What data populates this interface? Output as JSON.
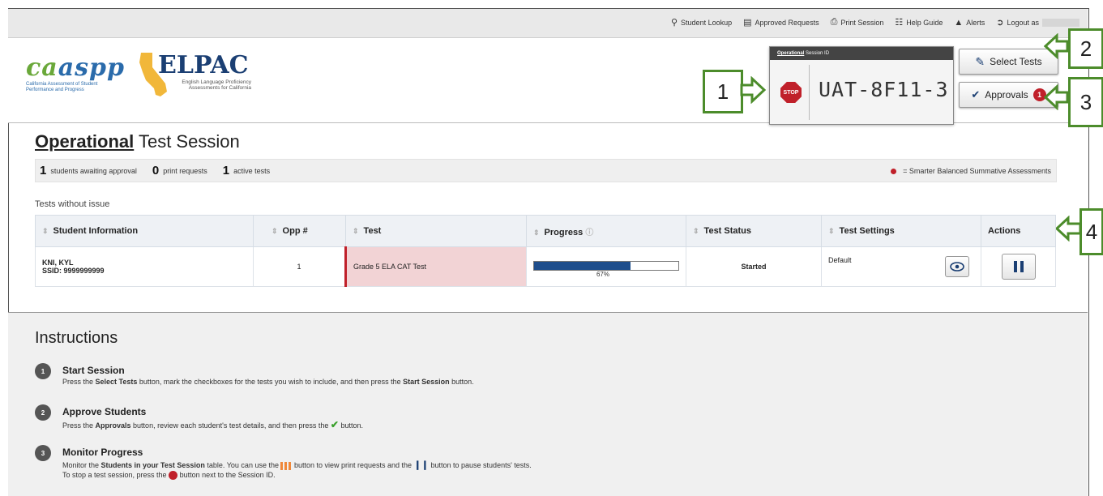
{
  "topnav": {
    "student_lookup": "Student Lookup",
    "approved_requests": "Approved Requests",
    "print_session": "Print Session",
    "help_guide": "Help Guide",
    "alerts": "Alerts",
    "logout": "Logout as"
  },
  "branding": {
    "caaspp_word_1": "ca",
    "caaspp_word_2": "aspp",
    "caaspp_sub": "California Assessment of Student Performance and Progress",
    "elpac_word": "ELPAC",
    "elpac_sub": "English Language Proficiency Assessments for California"
  },
  "session": {
    "label_type": "Operational",
    "label_rest": "Session ID",
    "stop_label": "STOP",
    "id": "UAT-8F11-3"
  },
  "buttons": {
    "select_tests": "Select Tests",
    "approvals": "Approvals",
    "approvals_count": "1"
  },
  "callouts": [
    "1",
    "2",
    "3",
    "4"
  ],
  "page": {
    "title_bold": "Operational",
    "title_rest": " Test Session"
  },
  "stats": {
    "awaiting_count": "1",
    "awaiting_label": "students awaiting approval",
    "print_count": "0",
    "print_label": "print requests",
    "active_count": "1",
    "active_label": "active tests",
    "legend_label": "= Smarter Balanced Summative Assessments"
  },
  "table": {
    "subheading": "Tests without issue",
    "headers": [
      "Student Information",
      "Opp #",
      "Test",
      "Progress",
      "Test Status",
      "Test Settings",
      "Actions"
    ],
    "rows": [
      {
        "student_name": "KNI, KYL",
        "ssid": "SSID: 9999999999",
        "opp": "1",
        "test": "Grade 5 ELA CAT Test",
        "progress_text": "67%",
        "progress_value": 0.67,
        "status": "Started",
        "settings": "Default"
      }
    ]
  },
  "instructions": {
    "heading": "Instructions",
    "steps": [
      {
        "num": "1",
        "title": "Start Session",
        "text_a": "Press the ",
        "text_b": "Select Tests",
        "text_c": " button, mark the checkboxes for the tests you wish to include, and then press the ",
        "text_d": "Start Session",
        "text_e": " button."
      },
      {
        "num": "2",
        "title": "Approve Students",
        "text_a": "Press the ",
        "text_b": "Approvals",
        "text_c": " button, review each student's test details, and then press the ",
        "text_e": " button."
      },
      {
        "num": "3",
        "title": "Monitor Progress",
        "text_a": "Monitor the ",
        "text_b": "Students in your Test Session",
        "text_c": " table. You can use the ",
        "text_d": " button to view print requests and the ",
        "text_e": " button to pause students' tests.",
        "text_f": "To stop a test session, press the ",
        "text_g": " button next to the Session ID."
      }
    ]
  },
  "colors": {
    "callout_green": "#4c8c2b",
    "stop_red": "#c0202a",
    "progress_blue": "#1f4e8c"
  }
}
